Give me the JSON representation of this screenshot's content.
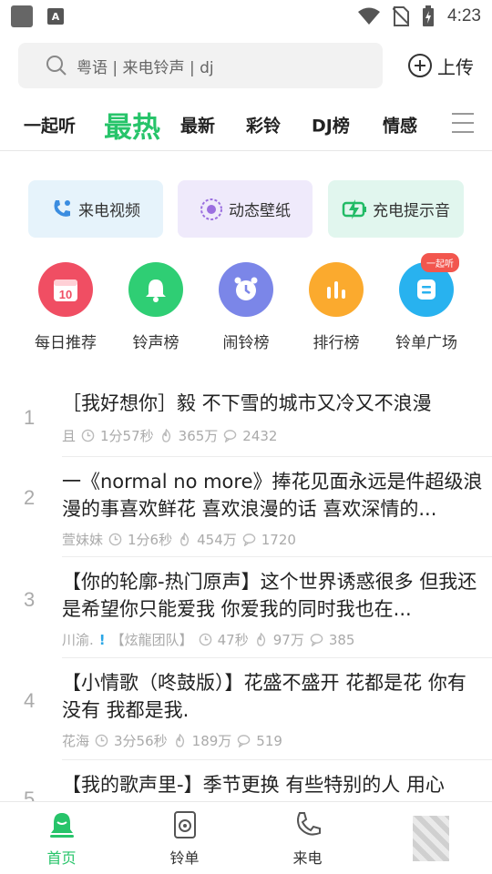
{
  "status_bar": {
    "time": "4:23",
    "app_icon_letter": "A"
  },
  "search": {
    "placeholder": "粤语 | 来电铃声 | dj",
    "upload_label": "上传"
  },
  "tabs": [
    {
      "label": "一起听",
      "active": false
    },
    {
      "label": "最热",
      "active": true
    },
    {
      "label": "最新",
      "active": false
    },
    {
      "label": "彩铃",
      "active": false
    },
    {
      "label": "DJ榜",
      "active": false
    },
    {
      "label": "情感",
      "active": false
    }
  ],
  "feature_cards": [
    {
      "label": "来电视频",
      "icon": "incoming-call-icon",
      "color": "#3b8de0"
    },
    {
      "label": "动态壁纸",
      "icon": "live-wallpaper-icon",
      "color": "#9b6fe0"
    },
    {
      "label": "充电提示音",
      "icon": "charging-icon",
      "color": "#22bb66"
    }
  ],
  "icon_grid": [
    {
      "label": "每日推荐",
      "icon": "calendar-icon",
      "day": "10",
      "color": "#f04e63"
    },
    {
      "label": "铃声榜",
      "icon": "bell-icon",
      "color": "#2fce74"
    },
    {
      "label": "闹铃榜",
      "icon": "alarm-clock-icon",
      "color": "#7b86e8"
    },
    {
      "label": "排行榜",
      "icon": "bar-chart-icon",
      "color": "#fbaa2e"
    },
    {
      "label": "铃单广场",
      "icon": "playlist-icon",
      "color": "#28b2ef",
      "badge": "一起听"
    }
  ],
  "songs": [
    {
      "rank": "1",
      "title": "［我好想你］毅  不下雪的城市又冷又不浪漫",
      "author": "且",
      "duration": "1分57秒",
      "plays": "365万",
      "comments": "2432"
    },
    {
      "rank": "2",
      "title": "一《normal no more》捧花见面永远是件超级浪漫的事喜欢鲜花 喜欢浪漫的话 喜欢深情的...",
      "author": "萱妹妹",
      "duration": "1分6秒",
      "plays": "454万",
      "comments": "1720"
    },
    {
      "rank": "3",
      "title": "【你的轮廓-热门原声】这个世界诱惑很多 但我还是希望你只能爱我 你爱我的同时我也在...",
      "author": "川渝.",
      "verified_mark": "!",
      "team": "【炫龍团队】",
      "duration": "47秒",
      "plays": "97万",
      "comments": "385"
    },
    {
      "rank": "4",
      "title": "【小情歌（咚鼓版）】花盛不盛开 花都是花 你有没有 我都是我.",
      "author": "花海",
      "duration": "3分56秒",
      "plays": "189万",
      "comments": "519"
    },
    {
      "rank": "5",
      "title": "【我的歌声里-】季节更换 有些特别的人 用心"
    }
  ],
  "bottom_nav": [
    {
      "label": "首页",
      "active": true,
      "icon": "home-bell-icon"
    },
    {
      "label": "铃单",
      "active": false,
      "icon": "speaker-icon"
    },
    {
      "label": "来电",
      "active": false,
      "icon": "phone-icon"
    },
    {
      "label": "",
      "active": false,
      "icon": "profile-icon"
    }
  ],
  "colors": {
    "accent": "#27c46a",
    "meta_gray": "#aaaaaa"
  }
}
